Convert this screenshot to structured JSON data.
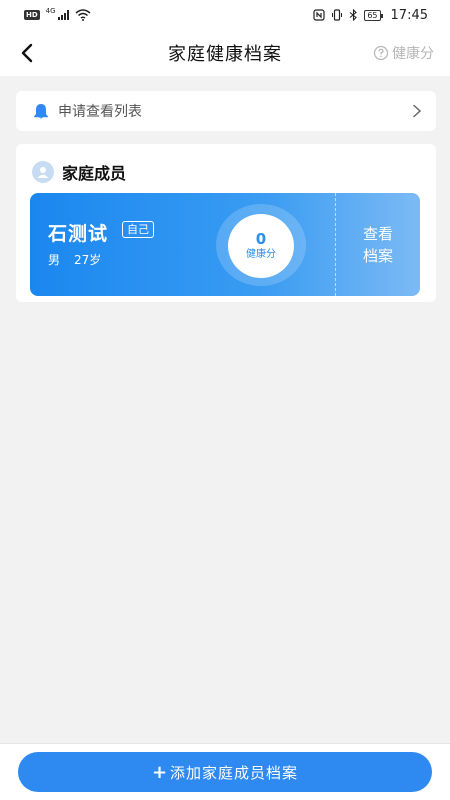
{
  "status_bar": {
    "left_badge": "HD",
    "network": "4G",
    "battery": "65",
    "time": "17:45"
  },
  "navbar": {
    "title": "家庭健康档案",
    "right_label": "健康分",
    "right_icon": "question-circle-icon"
  },
  "request": {
    "label": "申请查看列表",
    "icon": "bell-icon"
  },
  "members": {
    "title": "家庭成员",
    "items": [
      {
        "name": "石测试",
        "tag": "自己",
        "gender": "男",
        "age": "27岁",
        "score": "0",
        "score_label": "健康分",
        "view_label_line1": "查看",
        "view_label_line2": "档案"
      }
    ]
  },
  "bottom": {
    "add_label": "添加家庭成员档案"
  },
  "colors": {
    "accent": "#2e8af1",
    "background": "#f2f2f2"
  }
}
